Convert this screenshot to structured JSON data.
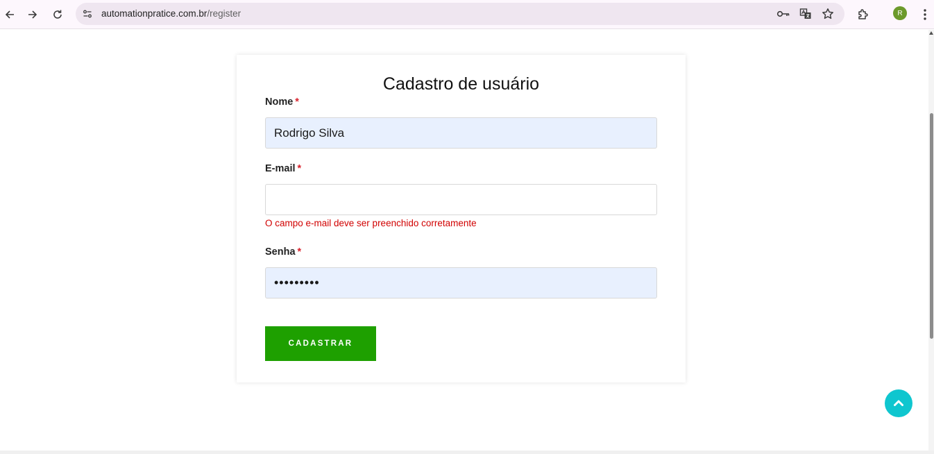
{
  "browser": {
    "url_host": "automationpratice.com.br",
    "url_path": "/register",
    "profile_initial": "R",
    "icons": {
      "back": "back-arrow-icon",
      "forward": "forward-arrow-icon",
      "reload": "reload-icon",
      "site_info": "site-settings-icon",
      "password": "key-icon",
      "translate": "translate-icon",
      "bookmark": "star-icon",
      "extensions": "puzzle-icon",
      "menu": "kebab-menu-icon"
    },
    "colors": {
      "toolbar": "#fdf7fd",
      "omnibox": "#efe6f0",
      "avatar": "#6c9a2b"
    }
  },
  "form": {
    "title": "Cadastro de usuário",
    "required_mark": "*",
    "name_label": "Nome",
    "name_value": "Rodrigo Silva",
    "email_label": "E-mail",
    "email_value": "",
    "email_error": "O campo e-mail deve ser preenchido corretamente",
    "password_label": "Senha",
    "password_value": "•••••••••",
    "submit_label": "CADASTRAR"
  },
  "page": {
    "scroll_to_top_icon": "chevron-up-icon",
    "colors": {
      "submit": "#1ea000",
      "error": "#d10000",
      "required": "#d9232d",
      "autofill": "#e8f0fe",
      "scroll_to_top": "#0fc6cf"
    }
  }
}
